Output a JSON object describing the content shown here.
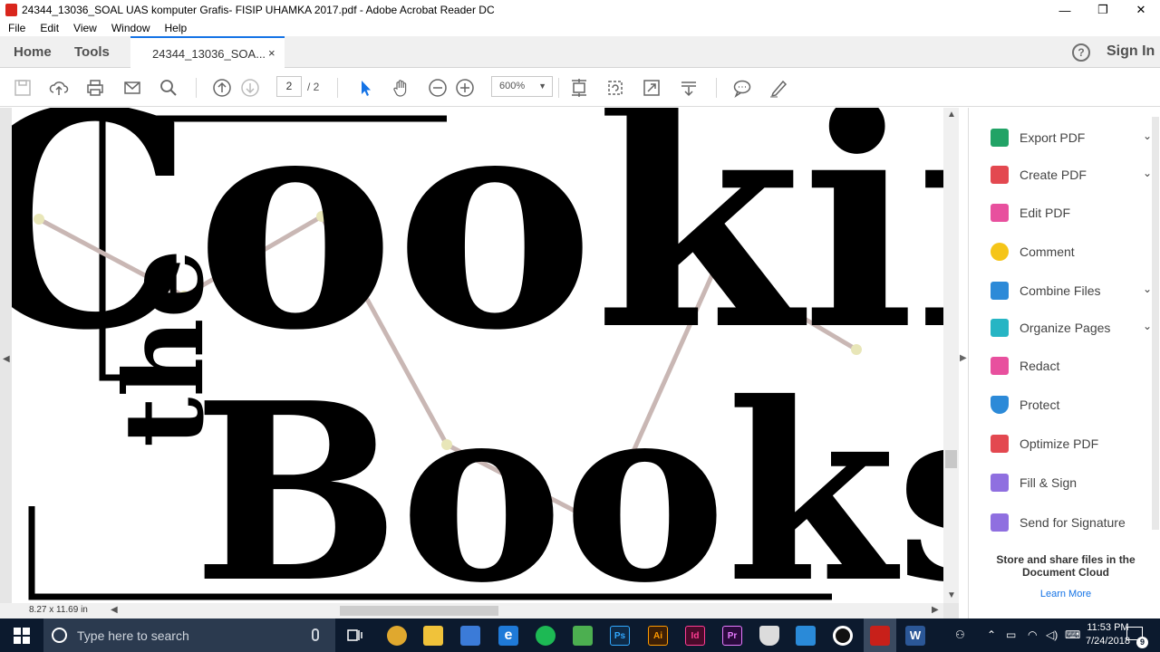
{
  "window": {
    "title": "24344_13036_SOAL UAS komputer Grafis- FISIP UHAMKA 2017.pdf - Adobe Acrobat Reader DC",
    "minimize": "—",
    "maximize": "❐",
    "close": "✕"
  },
  "menu": [
    "File",
    "Edit",
    "View",
    "Window",
    "Help"
  ],
  "tabs": {
    "home": "Home",
    "tools": "Tools",
    "doc_tab": "24344_13036_SOA...",
    "doc_tab_close": "×",
    "help": "?",
    "sign_in": "Sign In"
  },
  "toolbar": {
    "current_page": "2",
    "total_pages": "/ 2",
    "zoom": "600%"
  },
  "document": {
    "page_size": "8.27 x 11.69 in",
    "artwork_words": [
      "Cooking",
      "the",
      "Books"
    ]
  },
  "right_pane": {
    "tools": [
      {
        "label": "Export PDF",
        "chevron": "⌄",
        "color": "#21a366"
      },
      {
        "label": "Create PDF",
        "chevron": "⌄",
        "color": "#e34850"
      },
      {
        "label": "Edit PDF",
        "chevron": "",
        "color": "#e8509e"
      },
      {
        "label": "Comment",
        "chevron": "",
        "color": "#f5c518"
      },
      {
        "label": "Combine Files",
        "chevron": "⌄",
        "color": "#2c8ad8"
      },
      {
        "label": "Organize Pages",
        "chevron": "⌄",
        "color": "#26b5c4"
      },
      {
        "label": "Redact",
        "chevron": "",
        "color": "#e8509e"
      },
      {
        "label": "Protect",
        "chevron": "",
        "color": "#2c8ad8"
      },
      {
        "label": "Optimize PDF",
        "chevron": "",
        "color": "#e34850"
      },
      {
        "label": "Fill & Sign",
        "chevron": "",
        "color": "#8f6fe0"
      },
      {
        "label": "Send for Signature",
        "chevron": "",
        "color": "#8f6fe0"
      }
    ],
    "cloud_text": "Store and share files in the Document Cloud",
    "learn_more": "Learn More"
  },
  "taskbar": {
    "search_placeholder": "Type here to search",
    "time": "11:53 PM",
    "date": "7/24/2018",
    "notification_count": "9",
    "apps": [
      {
        "name": "chrome",
        "label": "",
        "color": "#e0a82e"
      },
      {
        "name": "file-explorer",
        "label": "",
        "color": "#f0c23a"
      },
      {
        "name": "store",
        "label": "",
        "color": "#3b7bd8"
      },
      {
        "name": "edge",
        "label": "e",
        "color": "#1f7ad8"
      },
      {
        "name": "spotify",
        "label": "",
        "color": "#1db954"
      },
      {
        "name": "camtasia",
        "label": "",
        "color": "#4caf50"
      },
      {
        "name": "photoshop",
        "label": "Ps",
        "color": "#0e2a47"
      },
      {
        "name": "illustrator",
        "label": "Ai",
        "color": "#3d1f05"
      },
      {
        "name": "indesign",
        "label": "Id",
        "color": "#4a0a2a"
      },
      {
        "name": "premiere",
        "label": "Pr",
        "color": "#2a0a3d"
      },
      {
        "name": "security",
        "label": "",
        "color": "#dcdcdc"
      },
      {
        "name": "vscode",
        "label": "",
        "color": "#2a8ad8"
      },
      {
        "name": "recorder",
        "label": "",
        "color": "#111111"
      },
      {
        "name": "acrobat",
        "label": "",
        "color": "#c8201a"
      },
      {
        "name": "word",
        "label": "W",
        "color": "#2b5797"
      }
    ]
  }
}
